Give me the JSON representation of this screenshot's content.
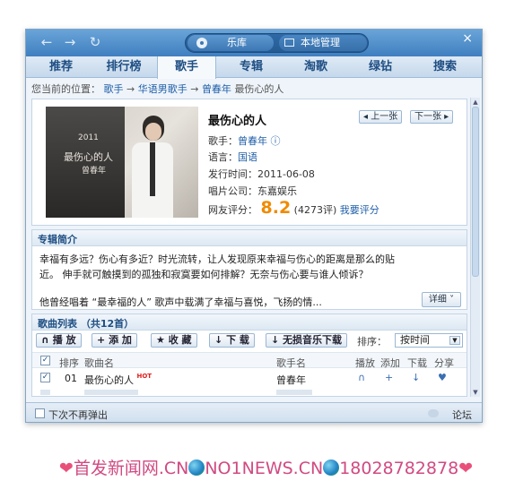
{
  "titlebar": {
    "back_icon": "back-arrow-icon",
    "forward_icon": "forward-arrow-icon",
    "refresh_icon": "refresh-icon",
    "source_tabs": [
      {
        "label": "乐库",
        "icon": "music-disc-icon"
      },
      {
        "label": "本地管理",
        "icon": "monitor-icon"
      }
    ],
    "close_label": "×"
  },
  "tabs": [
    "推荐",
    "排行榜",
    "歌手",
    "专辑",
    "淘歌",
    "绿钻",
    "搜索"
  ],
  "active_tab": "歌手",
  "breadcrumb": {
    "prefix": "您当前的位置：",
    "items": [
      "歌手",
      "华语男歌手",
      "曾春年",
      "最伤心的人"
    ],
    "separator": "→"
  },
  "album": {
    "title": "最伤心的人",
    "prev_label": "◂ 上一张",
    "next_label": "下一张 ▸",
    "cover": {
      "year": "2011",
      "title": "最伤心的人",
      "artist": "曾春年"
    },
    "singer_label": "歌手：",
    "singer": "曾春年",
    "language_label": "语言：",
    "language": "国语",
    "release_label": "发行时间：",
    "release_date": "2011-06-08",
    "label_label": "唱片公司：",
    "label": "东嘉娱乐",
    "rating_label": "网友评分：",
    "rating": "8.2",
    "rating_count": "(4273评)",
    "rate_link": "我要评分"
  },
  "intro": {
    "heading": "专辑简介",
    "line1": "幸福有多远？伤心有多近？时光流转，让人发现原来幸福与伤心的距离是那么的贴",
    "line2": "近。 伸手就可触摸到的孤独和寂寞要如何排解？无奈与伤心要与谁人倾诉？",
    "line3": "他曾经唱着 “最幸福的人” 歌声中载满了幸福与喜悦，飞扬的情...",
    "detail_label": "详细"
  },
  "song_list": {
    "heading": "歌曲列表 （共12首）",
    "toolbar": {
      "play": "播 放",
      "add": "添 加",
      "favorite": "收 藏",
      "download": "下 载",
      "lossless": "无损音乐下载"
    },
    "sort_label": "排序：",
    "sort_value": "按时间",
    "columns": [
      "排序",
      "歌曲名",
      "歌手名",
      "播放",
      "添加",
      "下载",
      "分享"
    ],
    "rows": [
      {
        "num": "01",
        "title": "最伤心的人",
        "badge": "HOT",
        "artist": "曾春年"
      }
    ]
  },
  "footer": {
    "dont_show": "下次不再弹出",
    "forum": "论坛"
  },
  "watermark": {
    "text1": "首发新闻网.CN",
    "text2": "NO1NEWS.CN",
    "text3": "18028782878"
  }
}
